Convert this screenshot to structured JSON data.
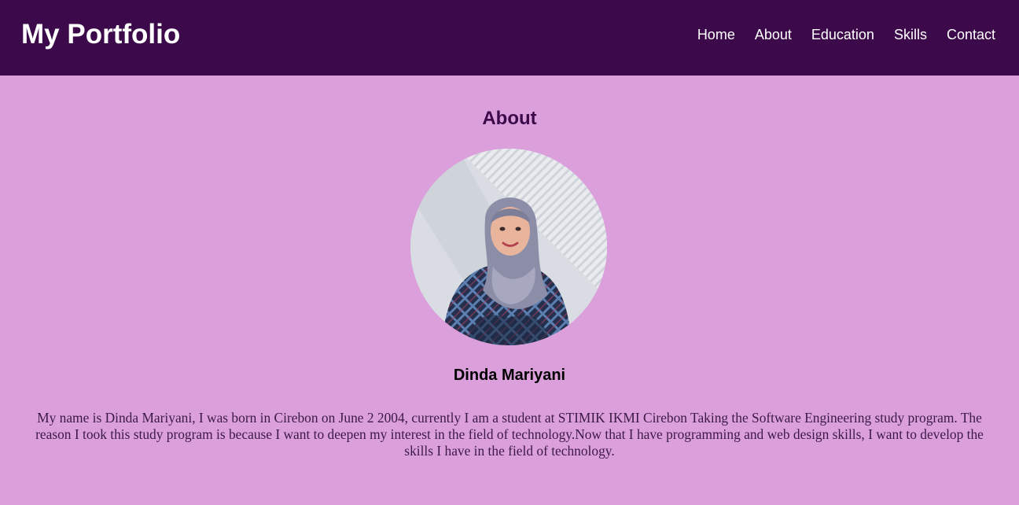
{
  "header": {
    "brand": "My Portfolio",
    "nav": [
      {
        "label": "Home"
      },
      {
        "label": "About"
      },
      {
        "label": "Education"
      },
      {
        "label": "Skills"
      },
      {
        "label": "Contact"
      }
    ]
  },
  "about": {
    "title": "About",
    "name": "Dinda Mariyani",
    "bio": "My name is Dinda Mariyani, I was born in Cirebon on June 2 2004, currently I am a student at STIMIK IKMI Cirebon Taking the Software Engineering study program. The reason I took this study program is because I want to deepen my interest in the field of technology.Now that I have programming and web design skills, I want to develop the skills I have in the field of technology."
  },
  "colors": {
    "header_bg": "#3c0a4a",
    "page_bg": "#dba0dc",
    "title": "#3c0a4a",
    "nav_text": "#ffffff"
  }
}
